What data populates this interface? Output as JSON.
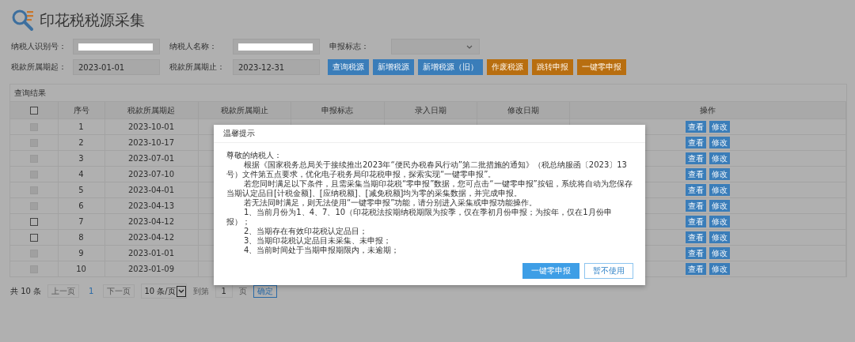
{
  "page": {
    "title": "印花税税源采集"
  },
  "form": {
    "fields": [
      {
        "label": "纳税人识别号：",
        "kind": "redacted"
      },
      {
        "label": "纳税人名称：",
        "kind": "redacted"
      },
      {
        "label": "申报标志：",
        "kind": "select"
      },
      {
        "label": "税款所属期起：",
        "kind": "text",
        "value": "2023-01-01"
      },
      {
        "label": "税款所属期止：",
        "kind": "text",
        "value": "2023-12-31"
      }
    ],
    "buttons": [
      {
        "label": "查询税源",
        "kind": "primary"
      },
      {
        "label": "新增税源",
        "kind": "primary"
      },
      {
        "label": "新增税源（旧）",
        "kind": "primary"
      },
      {
        "label": "作废税源",
        "kind": "warning"
      },
      {
        "label": "跳转申报",
        "kind": "warning"
      },
      {
        "label": "一键零申报",
        "kind": "warning"
      }
    ]
  },
  "results": {
    "title": "查询结果",
    "header_checked": false,
    "columns": [
      "序号",
      "税款所属期起",
      "税款所属期止",
      "申报标志",
      "录入日期",
      "修改日期",
      "操作"
    ],
    "rows": [
      {
        "disabled": true,
        "cells": [
          "1",
          "2023-10-01"
        ],
        "actions": [
          "查看",
          "修改"
        ]
      },
      {
        "disabled": true,
        "cells": [
          "2",
          "2023-10-17"
        ],
        "actions": [
          "查看",
          "修改"
        ]
      },
      {
        "disabled": true,
        "cells": [
          "3",
          "2023-07-01"
        ],
        "actions": [
          "查看",
          "修改"
        ]
      },
      {
        "disabled": true,
        "cells": [
          "4",
          "2023-07-10"
        ],
        "actions": [
          "查看",
          "修改"
        ]
      },
      {
        "disabled": true,
        "cells": [
          "5",
          "2023-04-01"
        ],
        "actions": [
          "查看",
          "修改"
        ]
      },
      {
        "disabled": true,
        "cells": [
          "6",
          "2023-04-13"
        ],
        "actions": [
          "查看",
          "修改"
        ]
      },
      {
        "disabled": false,
        "cells": [
          "7",
          "2023-04-12"
        ],
        "actions": [
          "查看",
          "修改"
        ]
      },
      {
        "disabled": false,
        "cells": [
          "8",
          "2023-04-12"
        ],
        "actions": [
          "查看",
          "修改"
        ]
      },
      {
        "disabled": true,
        "cells": [
          "9",
          "2023-01-01"
        ],
        "actions": [
          "查看",
          "修改"
        ]
      },
      {
        "disabled": true,
        "cells": [
          "10",
          "2023-01-09"
        ],
        "actions": [
          "查看",
          "修改"
        ]
      }
    ]
  },
  "pagination": {
    "total": "共 10 条",
    "prev": "上一页",
    "page": "1",
    "next": "下一页",
    "page_size": "10 条/页",
    "goto_label": "到第",
    "goto_value": "1",
    "page_unit": "页",
    "confirm": "确定"
  },
  "dialog": {
    "title": "温馨提示",
    "paragraphs": [
      {
        "kind": "greeting",
        "text": "尊敬的纳税人："
      },
      {
        "kind": "para",
        "text": "根据《国家税务总局关于接续推出2023年“便民办税春风行动”第二批措施的通知》（税总纳服函〔2023〕13号）文件第五点要求，优化电子税务局印花税申报，探索实现“一键零申报”。"
      },
      {
        "kind": "para",
        "text": "若您同时满足以下条件，且需采集当期印花税“零申报”数据，您可点击“一键零申报”按钮，系统将自动为您保存当期认定品目[计税金额]、[应纳税额]、[减免税额]均为零的采集数据，并完成申报。"
      },
      {
        "kind": "para",
        "text": "若无法同时满足，则无法使用“一键零申报”功能，请分别进入采集或申报功能操作。"
      },
      {
        "kind": "para",
        "text": "1、当前月份为1、4、7、10（印花税法按期纳税期限为按季，仅在季初月份申报；为按年，仅在1月份申报）；"
      },
      {
        "kind": "para",
        "text": "2、当期存在有效印花税认定品目；"
      },
      {
        "kind": "para",
        "text": "3、当期印花税认定品目未采集、未申报；"
      },
      {
        "kind": "para",
        "text": "4、当前时间处于当期申报期限内，未逾期；"
      }
    ],
    "buttons": [
      {
        "label": "一键零申报",
        "kind": "primary"
      },
      {
        "label": "暂不使用",
        "kind": "plain"
      }
    ]
  }
}
